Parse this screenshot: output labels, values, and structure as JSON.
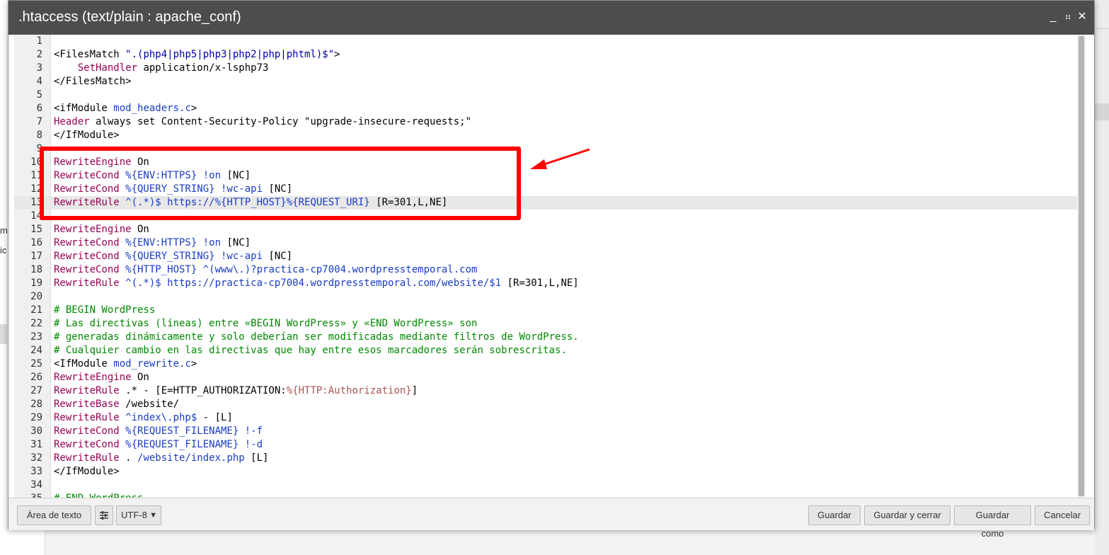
{
  "dialog": {
    "title": ".htaccess (text/plain : apache_conf)",
    "controls": {
      "minimize": "_",
      "maximize": "⠶",
      "close": "✕"
    }
  },
  "background": {
    "fragment_1": "m",
    "fragment_2": "ic"
  },
  "editor": {
    "active_line": 13,
    "lines": [
      {
        "n": "1",
        "parts": []
      },
      {
        "n": "2",
        "parts": [
          {
            "t": "<FilesMatch ",
            "c": "tag"
          },
          {
            "t": "\".(php4|php5|php3|php2|php|phtml)$\"",
            "c": "str"
          },
          {
            "t": ">",
            "c": "tag"
          }
        ]
      },
      {
        "n": "3",
        "parts": [
          {
            "t": "    ",
            "c": "tag"
          },
          {
            "t": "SetHandler",
            "c": "dir"
          },
          {
            "t": " application/x-lsphp73",
            "c": "tag"
          }
        ]
      },
      {
        "n": "4",
        "parts": [
          {
            "t": "</FilesMatch>",
            "c": "tag"
          }
        ]
      },
      {
        "n": "5",
        "parts": []
      },
      {
        "n": "6",
        "parts": [
          {
            "t": "<ifModule ",
            "c": "tag"
          },
          {
            "t": "mod_headers.c",
            "c": "var"
          },
          {
            "t": ">",
            "c": "tag"
          }
        ]
      },
      {
        "n": "7",
        "parts": [
          {
            "t": "Header",
            "c": "dir"
          },
          {
            "t": " always set Content-Security-Policy \"upgrade-insecure-requests;\"",
            "c": "tag"
          }
        ]
      },
      {
        "n": "8",
        "parts": [
          {
            "t": "</IfModule>",
            "c": "tag"
          }
        ]
      },
      {
        "n": "9",
        "parts": []
      },
      {
        "n": "10",
        "parts": [
          {
            "t": "RewriteEngine",
            "c": "dir"
          },
          {
            "t": " On",
            "c": "tag"
          }
        ]
      },
      {
        "n": "11",
        "parts": [
          {
            "t": "RewriteCond",
            "c": "dir"
          },
          {
            "t": " %{ENV:HTTPS}",
            "c": "var"
          },
          {
            "t": " !on",
            "c": "var"
          },
          {
            "t": " [NC]",
            "c": "tag"
          }
        ]
      },
      {
        "n": "12",
        "parts": [
          {
            "t": "RewriteCond",
            "c": "dir"
          },
          {
            "t": " %{QUERY_STRING}",
            "c": "var"
          },
          {
            "t": " !wc-api",
            "c": "var"
          },
          {
            "t": " [NC]",
            "c": "tag"
          }
        ]
      },
      {
        "n": "13",
        "parts": [
          {
            "t": "RewriteRule",
            "c": "dir"
          },
          {
            "t": " ^(.*)$ https://",
            "c": "var"
          },
          {
            "t": "%{HTTP_HOST}",
            "c": "var"
          },
          {
            "t": "%{REQUEST_URI}",
            "c": "var"
          },
          {
            "t": " ",
            "c": "tag"
          },
          {
            "t": "[R=301,L,NE]",
            "c": "tag"
          }
        ]
      },
      {
        "n": "14",
        "parts": []
      },
      {
        "n": "15",
        "parts": [
          {
            "t": "RewriteEngine",
            "c": "dir"
          },
          {
            "t": " On",
            "c": "tag"
          }
        ]
      },
      {
        "n": "16",
        "parts": [
          {
            "t": "RewriteCond",
            "c": "dir"
          },
          {
            "t": " %{ENV:HTTPS}",
            "c": "var"
          },
          {
            "t": " !on",
            "c": "var"
          },
          {
            "t": " [NC]",
            "c": "tag"
          }
        ]
      },
      {
        "n": "17",
        "parts": [
          {
            "t": "RewriteCond",
            "c": "dir"
          },
          {
            "t": " %{QUERY_STRING}",
            "c": "var"
          },
          {
            "t": " !wc-api",
            "c": "var"
          },
          {
            "t": " [NC]",
            "c": "tag"
          }
        ]
      },
      {
        "n": "18",
        "parts": [
          {
            "t": "RewriteCond",
            "c": "dir"
          },
          {
            "t": " %{HTTP_HOST}",
            "c": "var"
          },
          {
            "t": " ^(www\\.)?practica-cp7004.wordpresstemporal.com",
            "c": "var"
          }
        ]
      },
      {
        "n": "19",
        "parts": [
          {
            "t": "RewriteRule",
            "c": "dir"
          },
          {
            "t": " ^(.*)$ https://practica-cp7004.wordpresstemporal.com/website/$1",
            "c": "var"
          },
          {
            "t": " [R=301,L,NE]",
            "c": "tag"
          }
        ]
      },
      {
        "n": "20",
        "parts": []
      },
      {
        "n": "21",
        "parts": [
          {
            "t": "# BEGIN WordPress",
            "c": "cmt"
          }
        ]
      },
      {
        "n": "22",
        "parts": [
          {
            "t": "# Las directivas (líneas) entre «BEGIN WordPress» y «END WordPress» son",
            "c": "cmt"
          }
        ]
      },
      {
        "n": "23",
        "parts": [
          {
            "t": "# generadas dinámicamente y solo deberían ser modificadas mediante filtros de WordPress.",
            "c": "cmt"
          }
        ]
      },
      {
        "n": "24",
        "parts": [
          {
            "t": "# Cualquier cambio en las directivas que hay entre esos marcadores serán sobrescritas.",
            "c": "cmt"
          }
        ]
      },
      {
        "n": "25",
        "parts": [
          {
            "t": "<IfModule ",
            "c": "tag"
          },
          {
            "t": "mod_rewrite.c",
            "c": "var"
          },
          {
            "t": ">",
            "c": "tag"
          }
        ]
      },
      {
        "n": "26",
        "parts": [
          {
            "t": "RewriteEngine",
            "c": "dir"
          },
          {
            "t": " On",
            "c": "tag"
          }
        ]
      },
      {
        "n": "27",
        "parts": [
          {
            "t": "RewriteRule",
            "c": "dir"
          },
          {
            "t": " .* - [E=HTTP_AUTHORIZATION:",
            "c": "tag"
          },
          {
            "t": "%{HTTP:Authorization}",
            "c": "err"
          },
          {
            "t": "]",
            "c": "tag"
          }
        ]
      },
      {
        "n": "28",
        "parts": [
          {
            "t": "RewriteBase",
            "c": "dir"
          },
          {
            "t": " /website/",
            "c": "tag"
          }
        ]
      },
      {
        "n": "29",
        "parts": [
          {
            "t": "RewriteRule",
            "c": "dir"
          },
          {
            "t": " ^index\\.php$",
            "c": "var"
          },
          {
            "t": " - [L]",
            "c": "tag"
          }
        ]
      },
      {
        "n": "30",
        "parts": [
          {
            "t": "RewriteCond",
            "c": "dir"
          },
          {
            "t": " %{REQUEST_FILENAME}",
            "c": "var"
          },
          {
            "t": " !-f",
            "c": "var"
          }
        ]
      },
      {
        "n": "31",
        "parts": [
          {
            "t": "RewriteCond",
            "c": "dir"
          },
          {
            "t": " %{REQUEST_FILENAME}",
            "c": "var"
          },
          {
            "t": " !-d",
            "c": "var"
          }
        ]
      },
      {
        "n": "32",
        "parts": [
          {
            "t": "RewriteRule",
            "c": "dir"
          },
          {
            "t": " . ",
            "c": "tag"
          },
          {
            "t": "/website/index.php",
            "c": "var"
          },
          {
            "t": " [L]",
            "c": "tag"
          }
        ]
      },
      {
        "n": "33",
        "parts": [
          {
            "t": "</IfModule>",
            "c": "tag"
          }
        ]
      },
      {
        "n": "34",
        "parts": []
      },
      {
        "n": "35",
        "parts": [
          {
            "t": "# END WordPress",
            "c": "cmt"
          }
        ]
      }
    ]
  },
  "footer": {
    "textarea_button": "Área de texto",
    "encoding_selected": "UTF-8",
    "save": "Guardar",
    "save_close": "Guardar y cerrar",
    "save_as": "Guardar como",
    "cancel": "Cancelar"
  },
  "colors": {
    "annotation": "#ff0000",
    "titlebar": "#4d4d4d"
  }
}
